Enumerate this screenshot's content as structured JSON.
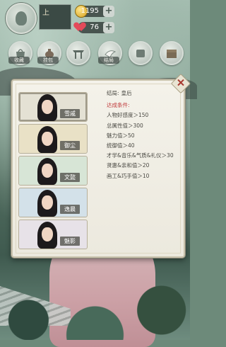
{
  "header": {
    "player_name": "上",
    "player_rank": "",
    "coins": "1195",
    "hearts": "76"
  },
  "nav": [
    {
      "label": "收藏",
      "icon": "bag-icon"
    },
    {
      "label": "挂包",
      "icon": "pouch-icon"
    },
    {
      "label": "",
      "icon": "gate-icon"
    },
    {
      "label": "结局",
      "icon": "bird-icon"
    },
    {
      "label": "",
      "icon": "seal-icon"
    },
    {
      "label": "",
      "icon": "chest-icon"
    }
  ],
  "characters": [
    {
      "name": "雪戚",
      "bg": "#e4e1d4",
      "selected": true
    },
    {
      "name": "御尘",
      "bg": "#e9e1c6",
      "selected": false
    },
    {
      "name": "文懿",
      "bg": "#d7e5d6",
      "selected": false
    },
    {
      "name": "逸晨",
      "bg": "#d3e1e9",
      "selected": false
    },
    {
      "name": "魅影",
      "bg": "#e7e2e8",
      "selected": false
    }
  ],
  "detail": {
    "ending_label": "结局:",
    "ending_value": "皇后",
    "conditions_title": "达成条件:",
    "conditions": [
      "人物好感度＞150",
      "总属性值＞300",
      "魅力值＞50",
      "统御值＞40",
      "才学&音乐&气质&礼仪＞30",
      "贤惠&亲和值＞20",
      "画工&巧手值＞10"
    ]
  },
  "colors": {
    "condition_title": "#c0393a",
    "dialog_bg": "#f4f2ea"
  }
}
